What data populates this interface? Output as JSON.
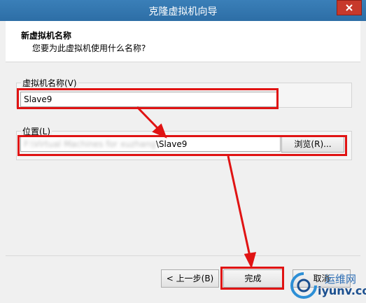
{
  "window": {
    "title": "克隆虚拟机向导"
  },
  "header": {
    "title": "新虚拟机名称",
    "subtitle": "您要为此虚拟机使用什么名称?"
  },
  "name_group": {
    "label": "虚拟机名称(V)",
    "value": "Slave9"
  },
  "location_group": {
    "label": "位置(L)",
    "value_blurred": "F:\\Virtual Machines for xuzhang",
    "value_suffix": "\\Slave9",
    "browse_label": "浏览(R)..."
  },
  "footer": {
    "back_label": "< 上一步(B)",
    "finish_label": "完成",
    "cancel_label": "取消"
  },
  "watermark": {
    "text1": "运维网",
    "text2": "iyunv.com"
  },
  "colors": {
    "annotation": "#e01313",
    "titlebar": "#3a7fb8",
    "close": "#c7392b"
  }
}
